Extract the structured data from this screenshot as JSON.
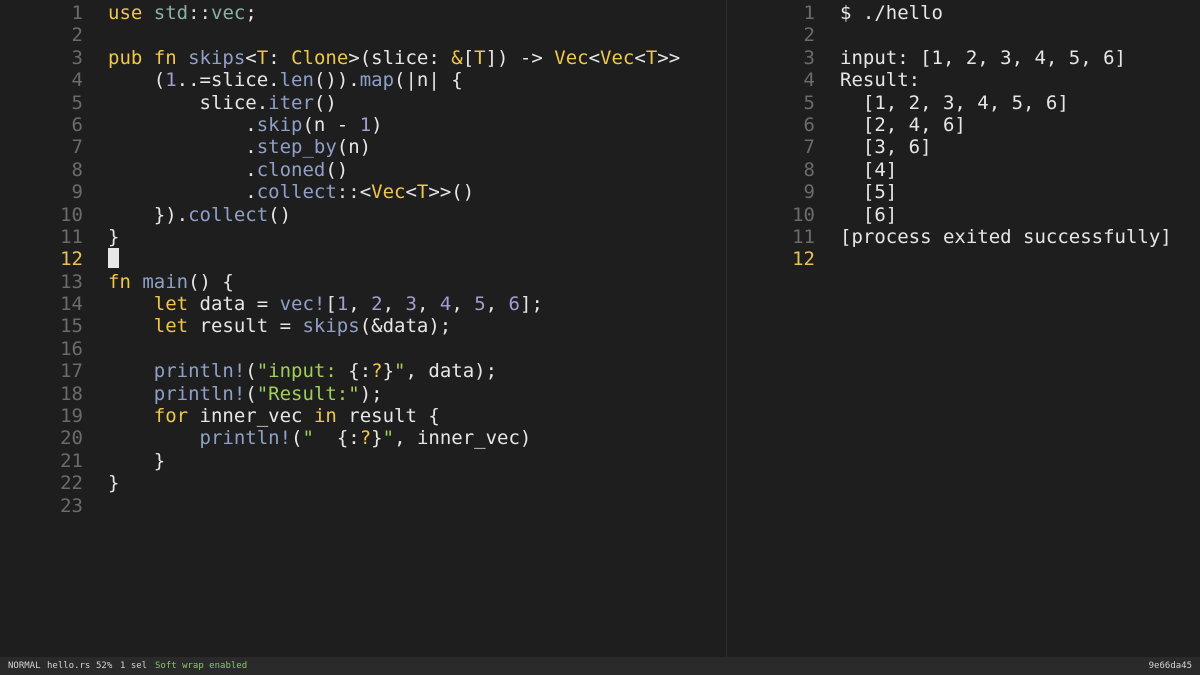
{
  "editor": {
    "file_name": "hello.rs",
    "active_line": "12",
    "lines": [
      {
        "n": "1",
        "tokens": [
          [
            "kw",
            "use"
          ],
          [
            "code",
            " "
          ],
          [
            "mod",
            "std"
          ],
          [
            "op",
            "::"
          ],
          [
            "mod",
            "vec"
          ],
          [
            "code",
            ";"
          ]
        ]
      },
      {
        "n": "2",
        "tokens": []
      },
      {
        "n": "3",
        "tokens": [
          [
            "kw",
            "pub fn"
          ],
          [
            "code",
            " "
          ],
          [
            "fn",
            "skips"
          ],
          [
            "code",
            "<"
          ],
          [
            "ty",
            "T"
          ],
          [
            "code",
            ": "
          ],
          [
            "ty",
            "Clone"
          ],
          [
            "code",
            ">(slice: "
          ],
          [
            "ty",
            "&"
          ],
          [
            "code",
            "["
          ],
          [
            "ty",
            "T"
          ],
          [
            "code",
            "]) -> "
          ],
          [
            "ty",
            "Vec"
          ],
          [
            "code",
            "<"
          ],
          [
            "ty",
            "Vec"
          ],
          [
            "code",
            "<"
          ],
          [
            "ty",
            "T"
          ],
          [
            "code",
            ">>"
          ]
        ]
      },
      {
        "n": "4",
        "tokens": [
          [
            "code",
            "    ("
          ],
          [
            "num",
            "1"
          ],
          [
            "code",
            "..=slice."
          ],
          [
            "fn",
            "len"
          ],
          [
            "code",
            "())."
          ],
          [
            "fn",
            "map"
          ],
          [
            "code",
            "(|n| {"
          ]
        ]
      },
      {
        "n": "5",
        "tokens": [
          [
            "code",
            "        slice."
          ],
          [
            "fn",
            "iter"
          ],
          [
            "code",
            "()"
          ]
        ]
      },
      {
        "n": "6",
        "tokens": [
          [
            "code",
            "            ."
          ],
          [
            "fn",
            "skip"
          ],
          [
            "code",
            "(n - "
          ],
          [
            "num",
            "1"
          ],
          [
            "code",
            ")"
          ]
        ]
      },
      {
        "n": "7",
        "tokens": [
          [
            "code",
            "            ."
          ],
          [
            "fn",
            "step_by"
          ],
          [
            "code",
            "(n)"
          ]
        ]
      },
      {
        "n": "8",
        "tokens": [
          [
            "code",
            "            ."
          ],
          [
            "fn",
            "cloned"
          ],
          [
            "code",
            "()"
          ]
        ]
      },
      {
        "n": "9",
        "tokens": [
          [
            "code",
            "            ."
          ],
          [
            "fn",
            "collect"
          ],
          [
            "op",
            "::"
          ],
          [
            "code",
            "<"
          ],
          [
            "ty",
            "Vec"
          ],
          [
            "code",
            "<"
          ],
          [
            "ty",
            "T"
          ],
          [
            "code",
            ">>()"
          ]
        ]
      },
      {
        "n": "10",
        "tokens": [
          [
            "code",
            "    })."
          ],
          [
            "fn",
            "collect"
          ],
          [
            "code",
            "()"
          ]
        ]
      },
      {
        "n": "11",
        "tokens": [
          [
            "code",
            "}"
          ]
        ]
      },
      {
        "n": "12",
        "tokens": [],
        "cursor": true
      },
      {
        "n": "13",
        "tokens": [
          [
            "kw",
            "fn"
          ],
          [
            "code",
            " "
          ],
          [
            "fn",
            "main"
          ],
          [
            "code",
            "() {"
          ]
        ]
      },
      {
        "n": "14",
        "tokens": [
          [
            "code",
            "    "
          ],
          [
            "kw",
            "let"
          ],
          [
            "code",
            " data = "
          ],
          [
            "fn",
            "vec!"
          ],
          [
            "code",
            "["
          ],
          [
            "num",
            "1"
          ],
          [
            "code",
            ", "
          ],
          [
            "num",
            "2"
          ],
          [
            "code",
            ", "
          ],
          [
            "num",
            "3"
          ],
          [
            "code",
            ", "
          ],
          [
            "num",
            "4"
          ],
          [
            "code",
            ", "
          ],
          [
            "num",
            "5"
          ],
          [
            "code",
            ", "
          ],
          [
            "num",
            "6"
          ],
          [
            "code",
            "];"
          ]
        ]
      },
      {
        "n": "15",
        "tokens": [
          [
            "code",
            "    "
          ],
          [
            "kw",
            "let"
          ],
          [
            "code",
            " result = "
          ],
          [
            "fn",
            "skips"
          ],
          [
            "code",
            "(&data);"
          ]
        ]
      },
      {
        "n": "16",
        "tokens": []
      },
      {
        "n": "17",
        "tokens": [
          [
            "code",
            "    "
          ],
          [
            "fn",
            "println!"
          ],
          [
            "code",
            "("
          ],
          [
            "str",
            "\"input: "
          ],
          [
            "code",
            "{:"
          ],
          [
            "kw",
            "?"
          ],
          [
            "code",
            "}"
          ],
          [
            "str",
            "\""
          ],
          [
            "code",
            ", data);"
          ]
        ]
      },
      {
        "n": "18",
        "tokens": [
          [
            "code",
            "    "
          ],
          [
            "fn",
            "println!"
          ],
          [
            "code",
            "("
          ],
          [
            "str",
            "\"Result:\""
          ],
          [
            "code",
            ");"
          ]
        ]
      },
      {
        "n": "19",
        "tokens": [
          [
            "code",
            "    "
          ],
          [
            "kw",
            "for"
          ],
          [
            "code",
            " inner_vec "
          ],
          [
            "kw",
            "in"
          ],
          [
            "code",
            " result {"
          ]
        ]
      },
      {
        "n": "20",
        "tokens": [
          [
            "code",
            "        "
          ],
          [
            "fn",
            "println!"
          ],
          [
            "code",
            "("
          ],
          [
            "str",
            "\"  "
          ],
          [
            "code",
            "{:"
          ],
          [
            "kw",
            "?"
          ],
          [
            "code",
            "}"
          ],
          [
            "str",
            "\""
          ],
          [
            "code",
            ", inner_vec)"
          ]
        ]
      },
      {
        "n": "21",
        "tokens": [
          [
            "code",
            "    }"
          ]
        ]
      },
      {
        "n": "22",
        "tokens": [
          [
            "code",
            "}"
          ]
        ]
      },
      {
        "n": "23",
        "tokens": []
      }
    ]
  },
  "terminal": {
    "active_line": "12",
    "lines": [
      {
        "n": "1",
        "text": "$ ./hello"
      },
      {
        "n": "2",
        "text": ""
      },
      {
        "n": "3",
        "text": "input: [1, 2, 3, 4, 5, 6]"
      },
      {
        "n": "4",
        "text": "Result:"
      },
      {
        "n": "5",
        "text": "  [1, 2, 3, 4, 5, 6]"
      },
      {
        "n": "6",
        "text": "  [2, 4, 6]"
      },
      {
        "n": "7",
        "text": "  [3, 6]"
      },
      {
        "n": "8",
        "text": "  [4]"
      },
      {
        "n": "9",
        "text": "  [5]"
      },
      {
        "n": "10",
        "text": "  [6]"
      },
      {
        "n": "11",
        "text": "[process exited successfully]"
      },
      {
        "n": "12",
        "text": ""
      }
    ]
  },
  "statusbar": {
    "mode": "NORMAL",
    "file": "hello.rs",
    "percent": "52%",
    "selection": "1 sel",
    "message": "Soft wrap enabled",
    "hash": "9e66da45"
  }
}
